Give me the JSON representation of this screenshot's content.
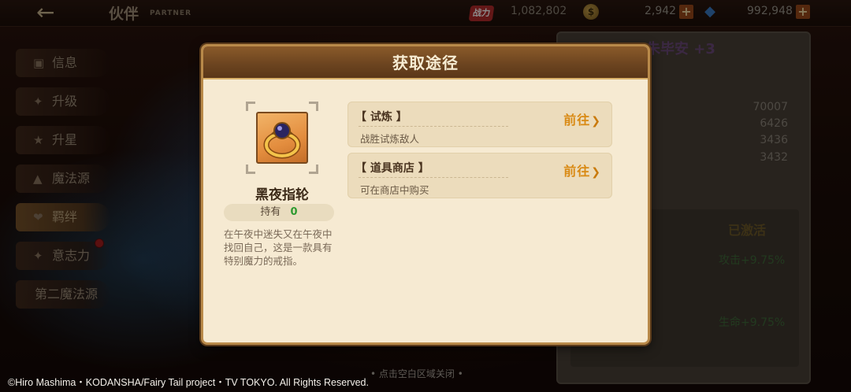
{
  "topbar": {
    "title": "伙伴",
    "subtitle": "PARTNER",
    "power_icon": "战力",
    "power_value": "1,082,802",
    "coin_value": "2,942",
    "gem_value": "992,948",
    "add_label": "+"
  },
  "side_menu": {
    "items": [
      {
        "label": "信息",
        "icon": "info-icon"
      },
      {
        "label": "升级",
        "icon": "level-up-icon"
      },
      {
        "label": "升星",
        "icon": "star-icon"
      },
      {
        "label": "魔法源",
        "icon": "magic-source-icon"
      },
      {
        "label": "羁绊",
        "icon": "bond-icon"
      },
      {
        "label": "意志力",
        "icon": "will-icon"
      },
      {
        "label": "第二魔法源"
      }
    ]
  },
  "right_panel": {
    "name": "朱毕安 +3",
    "stats": [
      "70007",
      "6426",
      "3436",
      "3432"
    ],
    "activated": "已激活",
    "bonuses": [
      "攻击+9.75%",
      "生命+9.75%"
    ]
  },
  "dialog": {
    "title": "获取途径",
    "item": {
      "icon": "ring-icon",
      "name": "黑夜指轮",
      "own_label": "持有",
      "own_value": "0",
      "description": "在午夜中迷失又在午夜中找回自己，这是一款具有特别魔力的戒指。"
    },
    "sources": [
      {
        "title": "【 试炼 】",
        "desc": "战胜试炼敌人",
        "go_label": "前往"
      },
      {
        "title": "【 道具商店 】",
        "desc": "可在商店中购买",
        "go_label": "前往"
      }
    ]
  },
  "tap_close_hint": "• 点击空白区域关闭 •",
  "copyright": "©Hiro Mashima・KODANSHA/Fairy Tail project・TV TOKYO. All Rights Reserved."
}
